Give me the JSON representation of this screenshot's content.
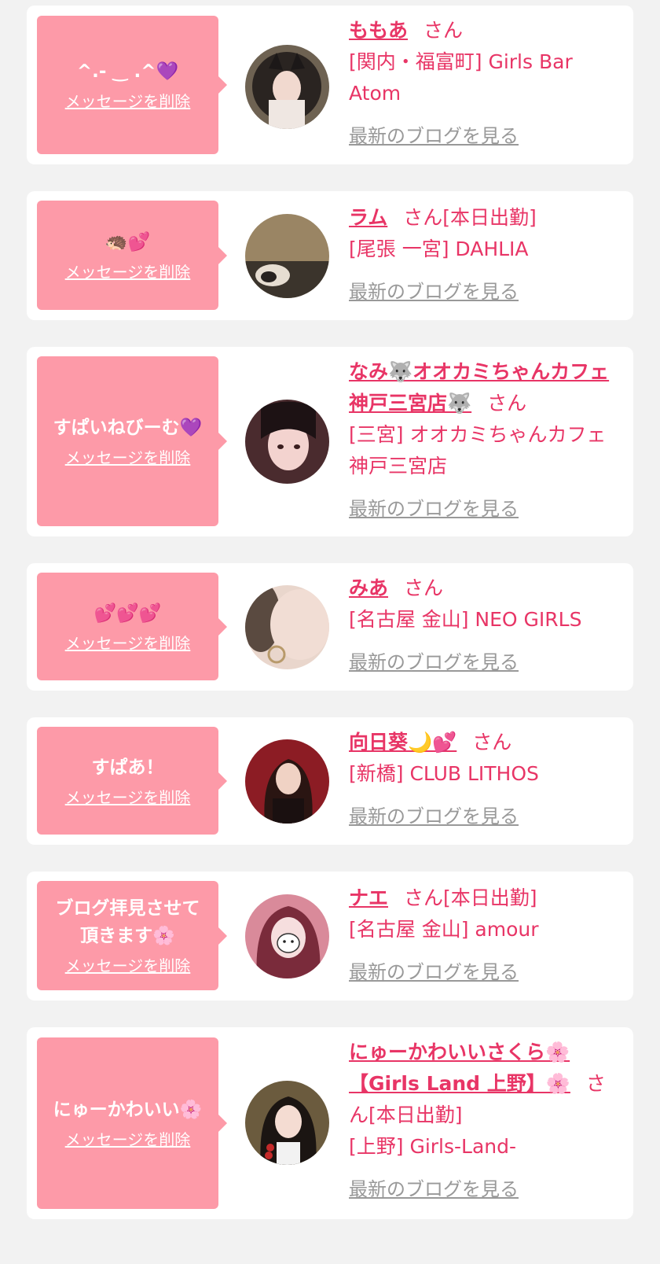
{
  "theme": {
    "bubble_color": "#fd9aa8",
    "accent_color": "#e83566",
    "muted_link_color": "#999999",
    "background": "#f2f2f2"
  },
  "items": [
    {
      "message": "^.- ‿ .^💜",
      "delete_label": "メッセージを削除",
      "name": "ももあ",
      "san": "さん",
      "shift": "",
      "shop": "[関内・福富町] Girls Bar Atom",
      "blog_label": "最新のブログを見る"
    },
    {
      "message": "🦔💕",
      "delete_label": "メッセージを削除",
      "name": "ラム",
      "san": "さん",
      "shift": "[本日出勤]",
      "shop": "[尾張 一宮] DAHLIA",
      "blog_label": "最新のブログを見る"
    },
    {
      "message": "すぱいねびーむ💜",
      "delete_label": "メッセージを削除",
      "name": "なみ🐺オオカミちゃんカフェ神戸三宮店🐺",
      "san": "さん",
      "shift": "",
      "shop": "[三宮] オオカミちゃんカフェ神戸三宮店",
      "blog_label": "最新のブログを見る"
    },
    {
      "message": "💕💕💕",
      "delete_label": "メッセージを削除",
      "name": "みあ",
      "san": "さん",
      "shift": "",
      "shop": "[名古屋 金山] NEO GIRLS",
      "blog_label": "最新のブログを見る"
    },
    {
      "message": "すぱあ！",
      "delete_label": "メッセージを削除",
      "name": "向日葵🌙💕",
      "san": "さん",
      "shift": "",
      "shop": "[新橋] CLUB LITHOS",
      "blog_label": "最新のブログを見る"
    },
    {
      "message": "ブログ拝見させて\n頂きます🌸",
      "delete_label": "メッセージを削除",
      "name": "ナエ",
      "san": "さん",
      "shift": "[本日出勤]",
      "shop": "[名古屋 金山] amour",
      "blog_label": "最新のブログを見る"
    },
    {
      "message": "にゅーかわいい🌸",
      "delete_label": "メッセージを削除",
      "name": "にゅーかわいいさくら🌸【Girls Land 上野】🌸",
      "san": "さん",
      "shift": "[本日出勤]",
      "shop": "[上野] Girls-Land-",
      "blog_label": "最新のブログを見る"
    }
  ]
}
